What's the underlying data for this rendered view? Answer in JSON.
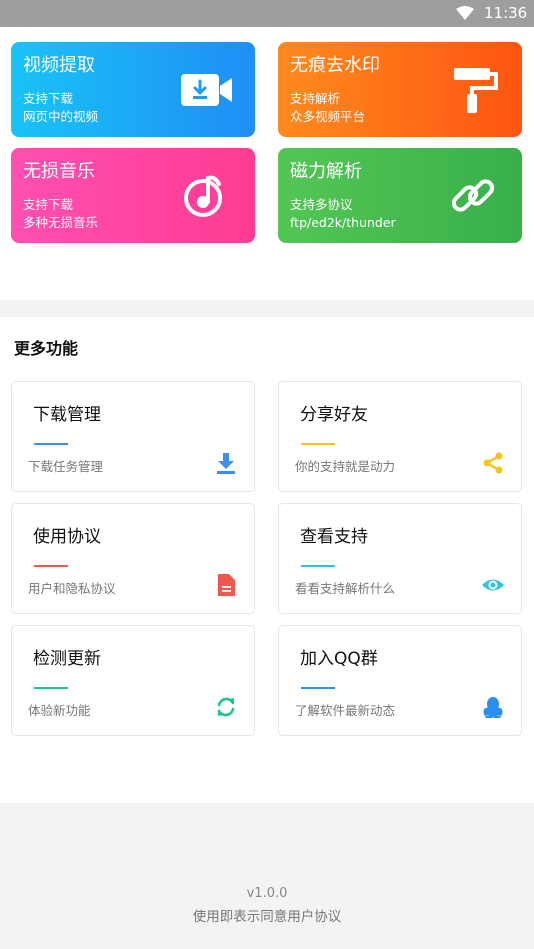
{
  "status_bar": {
    "time": "11:36",
    "wifi_icon": "wifi-icon"
  },
  "features": [
    {
      "title": "视频提取",
      "sub1": "支持下载",
      "sub2": "网页中的视频",
      "icon": "video-download-icon",
      "color_start": "#19c3f6",
      "color_end": "#1f8ef6"
    },
    {
      "title": "无痕去水印",
      "sub1": "支持解析",
      "sub2": "众多视频平台",
      "icon": "paint-roller-icon",
      "color_start": "#ff8a1e",
      "color_end": "#ff5511"
    },
    {
      "title": "无损音乐",
      "sub1": "支持下载",
      "sub2": "多种无损音乐",
      "icon": "music-note-icon",
      "color_start": "#ff4fb1",
      "color_end": "#ff3c93"
    },
    {
      "title": "磁力解析",
      "sub1": "支持多协议",
      "sub2": "ftp/ed2k/thunder",
      "icon": "link-icon",
      "color_start": "#53c655",
      "color_end": "#38b04a"
    }
  ],
  "more": {
    "title": "更多功能",
    "items": [
      {
        "title": "下载管理",
        "sub": "下载任务管理",
        "accent": "#3d8ef0",
        "icon": "download-icon"
      },
      {
        "title": "分享好友",
        "sub": "你的支持就是动力",
        "accent": "#f7c516",
        "icon": "share-icon"
      },
      {
        "title": "使用协议",
        "sub": "用户和隐私协议",
        "accent": "#f0574e",
        "icon": "document-icon"
      },
      {
        "title": "查看支持",
        "sub": "看看支持解析什么",
        "accent": "#2ec5e0",
        "icon": "eye-icon"
      },
      {
        "title": "检测更新",
        "sub": "体验新功能",
        "accent": "#21c48f",
        "icon": "refresh-icon"
      },
      {
        "title": "加入QQ群",
        "sub": "了解软件最新动态",
        "accent": "#2c8ef0",
        "icon": "qq-penguin-icon"
      }
    ]
  },
  "footer": {
    "version": "v1.0.0",
    "agreement": "使用即表示同意用户协议"
  }
}
